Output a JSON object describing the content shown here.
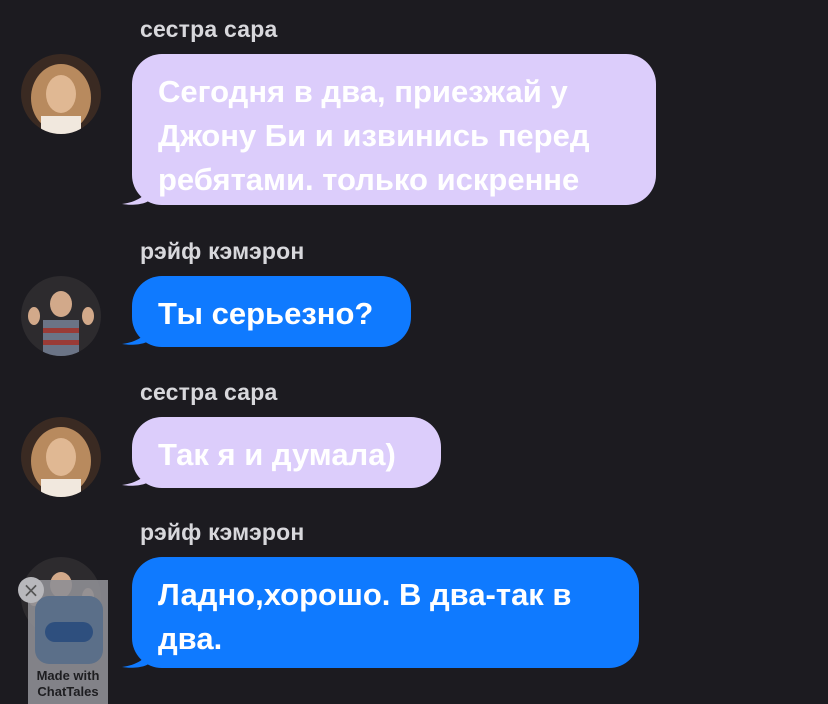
{
  "messages": [
    {
      "sender": "сестра сара",
      "avatar": "sara-avatar",
      "text": "Сегодня в два, приезжай у Джону Би и извинись перед ребятами. только искренне",
      "color": "#dccdfb"
    },
    {
      "sender": "рэйф кэмэрон",
      "avatar": "rafe-avatar",
      "text": "Ты серьезно?",
      "color": "#0f7aff"
    },
    {
      "sender": "сестра сара",
      "avatar": "sara-avatar",
      "text": "Так я и думала)",
      "color": "#dccdfb"
    },
    {
      "sender": "рэйф кэмэрон",
      "avatar": "rafe-avatar",
      "text": "Ладно,хорошо. В два-так в два.",
      "color": "#0f7aff"
    }
  ],
  "watermark": {
    "text": "Made with ChatTales",
    "close_icon": "close-icon"
  }
}
